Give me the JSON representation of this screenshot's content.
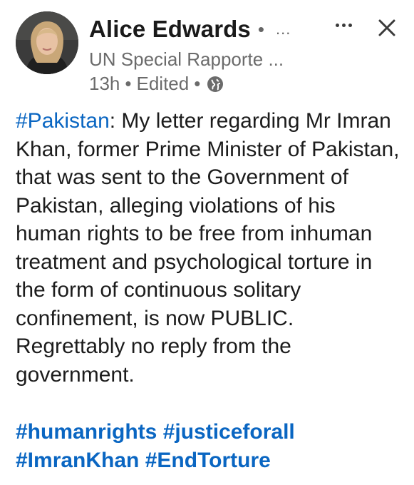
{
  "author": {
    "name": "Alice Edwards",
    "name_separator": "•",
    "follow_more": "...",
    "subtitle": "UN Special Rapporte ...",
    "time": "13h",
    "edited": "Edited",
    "dot": "•",
    "visibility_icon": "globe-icon",
    "avatar_icon": "profile-photo"
  },
  "actions": {
    "more_icon": "more-horizontal-icon",
    "close_icon": "close-icon"
  },
  "post": {
    "lead_hashtag": "#Pakistan",
    "text": ": My letter regarding Mr Imran Khan, former Prime Minister of Pakistan, that was sent to the Government of Pakistan, alleging violations of his human rights to be free from inhuman treatment and psychological torture in the form of continuous solitary confinement, is now PUBLIC. Regrettably no reply from the government."
  },
  "hashtags": [
    "#humanrights",
    "#justiceforall",
    "#ImranKhan",
    "#EndTorture"
  ],
  "colors": {
    "link": "#0a66c2",
    "text": "#1c1c1c",
    "muted": "#6b6b6b"
  }
}
